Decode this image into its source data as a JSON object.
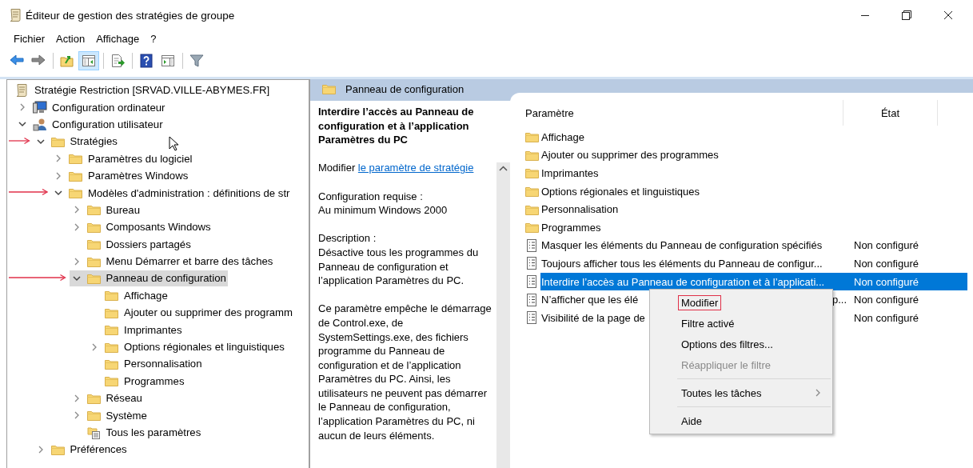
{
  "window": {
    "title": "Éditeur de gestion des stratégies de groupe"
  },
  "menu_bar": [
    "Fichier",
    "Action",
    "Affichage",
    "?"
  ],
  "toolbar": [
    [
      {
        "kind": "back",
        "pressed": false
      },
      {
        "kind": "forward",
        "pressed": false
      }
    ],
    [
      {
        "kind": "up",
        "pressed": false
      },
      {
        "kind": "tree-toggle",
        "pressed": true
      }
    ],
    [
      {
        "kind": "export",
        "pressed": false
      }
    ],
    [
      {
        "kind": "help",
        "pressed": false
      },
      {
        "kind": "action-pane",
        "pressed": false
      }
    ],
    [
      {
        "kind": "filter",
        "pressed": false
      }
    ]
  ],
  "tree": {
    "items": [
      {
        "label": "Stratégie Restriction [SRVAD.VILLE-ABYMES.FR]",
        "kind": "policy",
        "expandable": false,
        "selected": false,
        "marked": false,
        "children": [
          {
            "label": "Configuration ordinateur",
            "kind": "computer",
            "expandable": true,
            "expanded": false,
            "selected": false,
            "marked": false
          },
          {
            "label": "Configuration utilisateur",
            "kind": "user",
            "expandable": true,
            "expanded": true,
            "selected": false,
            "marked": false,
            "children": [
              {
                "label": "Stratégies",
                "kind": "folder",
                "expandable": true,
                "expanded": true,
                "selected": false,
                "marked": true,
                "children": [
                  {
                    "label": "Paramètres du logiciel",
                    "kind": "folder",
                    "expandable": true,
                    "expanded": false,
                    "selected": false,
                    "marked": false
                  },
                  {
                    "label": "Paramètres Windows",
                    "kind": "folder",
                    "expandable": true,
                    "expanded": false,
                    "selected": false,
                    "marked": false
                  },
                  {
                    "label": "Modèles d'administration : définitions de str",
                    "kind": "folder",
                    "expandable": true,
                    "expanded": true,
                    "selected": false,
                    "marked": true,
                    "children": [
                      {
                        "label": "Bureau",
                        "kind": "folder",
                        "expandable": true,
                        "expanded": false,
                        "selected": false,
                        "marked": false
                      },
                      {
                        "label": "Composants Windows",
                        "kind": "folder",
                        "expandable": true,
                        "expanded": false,
                        "selected": false,
                        "marked": false
                      },
                      {
                        "label": "Dossiers partagés",
                        "kind": "folder",
                        "expandable": false,
                        "selected": false,
                        "marked": false
                      },
                      {
                        "label": "Menu Démarrer et barre des tâches",
                        "kind": "folder",
                        "expandable": true,
                        "expanded": false,
                        "selected": false,
                        "marked": false
                      },
                      {
                        "label": "Panneau de configuration",
                        "kind": "folder",
                        "expandable": true,
                        "expanded": true,
                        "selected": true,
                        "marked": true,
                        "children": [
                          {
                            "label": "Affichage",
                            "kind": "folder",
                            "expandable": false,
                            "selected": false,
                            "marked": false
                          },
                          {
                            "label": "Ajouter ou supprimer des programm",
                            "kind": "folder",
                            "expandable": false,
                            "selected": false,
                            "marked": false
                          },
                          {
                            "label": "Imprimantes",
                            "kind": "folder",
                            "expandable": false,
                            "selected": false,
                            "marked": false
                          },
                          {
                            "label": "Options régionales et linguistiques",
                            "kind": "folder",
                            "expandable": true,
                            "expanded": false,
                            "selected": false,
                            "marked": false
                          },
                          {
                            "label": "Personnalisation",
                            "kind": "folder",
                            "expandable": false,
                            "selected": false,
                            "marked": false
                          },
                          {
                            "label": "Programmes",
                            "kind": "folder",
                            "expandable": false,
                            "selected": false,
                            "marked": false
                          }
                        ]
                      },
                      {
                        "label": "Réseau",
                        "kind": "folder",
                        "expandable": true,
                        "expanded": false,
                        "selected": false,
                        "marked": false
                      },
                      {
                        "label": "Système",
                        "kind": "folder",
                        "expandable": true,
                        "expanded": false,
                        "selected": false,
                        "marked": false
                      },
                      {
                        "label": "Tous les paramètres",
                        "kind": "settings-list",
                        "expandable": false,
                        "selected": false,
                        "marked": false
                      }
                    ]
                  }
                ]
              },
              {
                "label": "Préférences",
                "kind": "folder",
                "expandable": true,
                "expanded": false,
                "selected": false,
                "marked": false
              }
            ]
          }
        ]
      }
    ]
  },
  "details": {
    "header": "Panneau de configuration",
    "title": "Interdire l’accès au Panneau de configuration et à l’application Paramètres du PC",
    "edit_prefix": "Modifier",
    "edit_link": "le paramètre de stratégie",
    "requirements_label": "Configuration requise :",
    "requirements": "Au minimum Windows 2000",
    "description_label": "Description :",
    "paragraphs": [
      "Désactive tous les programmes du Panneau de configuration et l’application Paramètres du PC.",
      "Ce paramètre empêche le démarrage de Control.exe, de SystemSettings.exe, des fichiers programme du Panneau de configuration et de l’application Paramètres du PC. Ainsi, les utilisateurs ne peuvent pas démarrer le Panneau de configuration, l’application Paramètres du PC, ni aucun de leurs éléments."
    ]
  },
  "list": {
    "columns": [
      "Paramètre",
      "État"
    ],
    "rows": [
      {
        "kind": "folder",
        "name": "Affichage",
        "selected": false
      },
      {
        "kind": "folder",
        "name": "Ajouter ou supprimer des programmes",
        "selected": false
      },
      {
        "kind": "folder",
        "name": "Imprimantes",
        "selected": false
      },
      {
        "kind": "folder",
        "name": "Options régionales et linguistiques",
        "selected": false
      },
      {
        "kind": "folder",
        "name": "Personnalisation",
        "selected": false
      },
      {
        "kind": "folder",
        "name": "Programmes",
        "selected": false
      },
      {
        "kind": "setting",
        "name": "Masquer les éléments du Panneau de configuration spécifiés",
        "state": "Non configuré",
        "selected": false
      },
      {
        "kind": "setting",
        "name": "Toujours afficher tous les éléments du Panneau de configur...",
        "state": "Non configuré",
        "selected": false
      },
      {
        "kind": "setting",
        "name": "Interdire l’accès au Panneau de configuration et à l’applicati...",
        "state": "Non configuré",
        "selected": true
      },
      {
        "kind": "setting",
        "name": "N’afficher que les élé",
        "name_tail": "p...",
        "state": "Non configuré",
        "selected": false
      },
      {
        "kind": "setting",
        "name": "Visibilité de la page de",
        "state": "Non configuré",
        "selected": false
      }
    ]
  },
  "context_menu": [
    {
      "kind": "item",
      "label": "Modifier",
      "disabled": false,
      "highlighted": true,
      "submenu": false
    },
    {
      "kind": "item",
      "label": "Filtre activé",
      "disabled": false,
      "highlighted": false,
      "submenu": false
    },
    {
      "kind": "item",
      "label": "Options des filtres...",
      "disabled": false,
      "highlighted": false,
      "submenu": false
    },
    {
      "kind": "item",
      "label": "Réappliquer le filtre",
      "disabled": true,
      "highlighted": false,
      "submenu": false
    },
    {
      "kind": "separator"
    },
    {
      "kind": "item",
      "label": "Toutes les tâches",
      "disabled": false,
      "highlighted": false,
      "submenu": true
    },
    {
      "kind": "separator"
    },
    {
      "kind": "item",
      "label": "Aide",
      "disabled": false,
      "highlighted": false,
      "submenu": false
    }
  ]
}
